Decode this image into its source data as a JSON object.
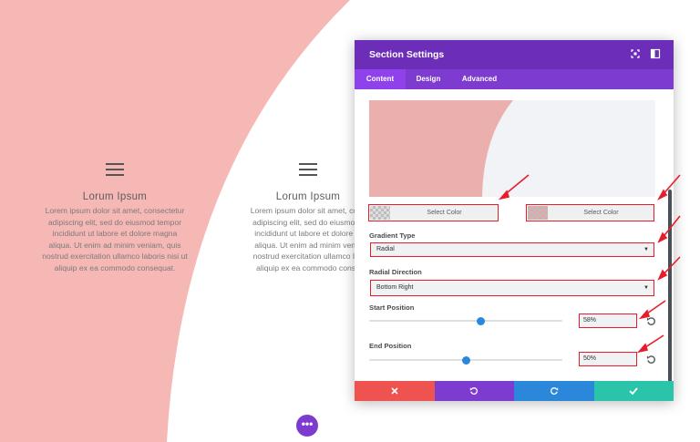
{
  "background": {
    "shape_color": "#f6b8b5",
    "page_color": "#ffffff"
  },
  "columns": [
    {
      "menu_icon": "hamburger-menu-icon",
      "title": "Lorum Ipsum",
      "lines": [
        "Lorem ipsum dolor sit amet, consectetur",
        "adipiscing elit, sed do eiusmod tempor",
        "incididunt ut labore et dolore magna",
        "aliqua. Ut enim ad minim veniam, quis",
        "nostrud exercitation ullamco laboris nisi ut",
        "aliquip ex ea commodo consequat."
      ]
    },
    {
      "menu_icon": "hamburger-menu-icon",
      "title": "Lorum Ipsum",
      "lines": [
        "Lorem ipsum dolor sit amet, cons",
        "adipiscing elit, sed do eiusmod t",
        "incididunt ut labore et dolore m",
        "aliqua. Ut enim ad minim venia",
        "nostrud exercitation ullamco lab",
        "aliquip ex ea commodo conse"
      ]
    }
  ],
  "panel": {
    "title": "Section Settings",
    "header_icons": [
      "expand-icon",
      "sidebar-toggle-icon"
    ],
    "tabs": [
      {
        "label": "Content",
        "active": true
      },
      {
        "label": "Design",
        "active": false
      },
      {
        "label": "Advanced",
        "active": false
      }
    ],
    "preview": {
      "color_left": "#ebb0ae",
      "color_right": "#f1f3f6"
    },
    "color_buttons": [
      {
        "label": "Select Color"
      },
      {
        "label": "Select Color"
      }
    ],
    "gradient_type": {
      "label": "Gradient Type",
      "value": "Radial"
    },
    "radial_direction": {
      "label": "Radial Direction",
      "value": "Bottom Right"
    },
    "start_position": {
      "label": "Start Position",
      "value": "58%",
      "fraction": 0.58
    },
    "end_position": {
      "label": "End Position",
      "value": "50%",
      "fraction": 0.5
    },
    "footer_buttons": [
      {
        "name": "cancel",
        "icon": "close-icon",
        "color": "#ef5350"
      },
      {
        "name": "undo",
        "icon": "undo-icon",
        "color": "#7e3bd0"
      },
      {
        "name": "redo",
        "icon": "redo-icon",
        "color": "#2b87da"
      },
      {
        "name": "save",
        "icon": "check-icon",
        "color": "#29c4a9"
      }
    ]
  },
  "annotation_color": "#e81c2a",
  "fab": {
    "icon": "more-options-icon",
    "label": "•••",
    "color": "#7e3bd0"
  }
}
